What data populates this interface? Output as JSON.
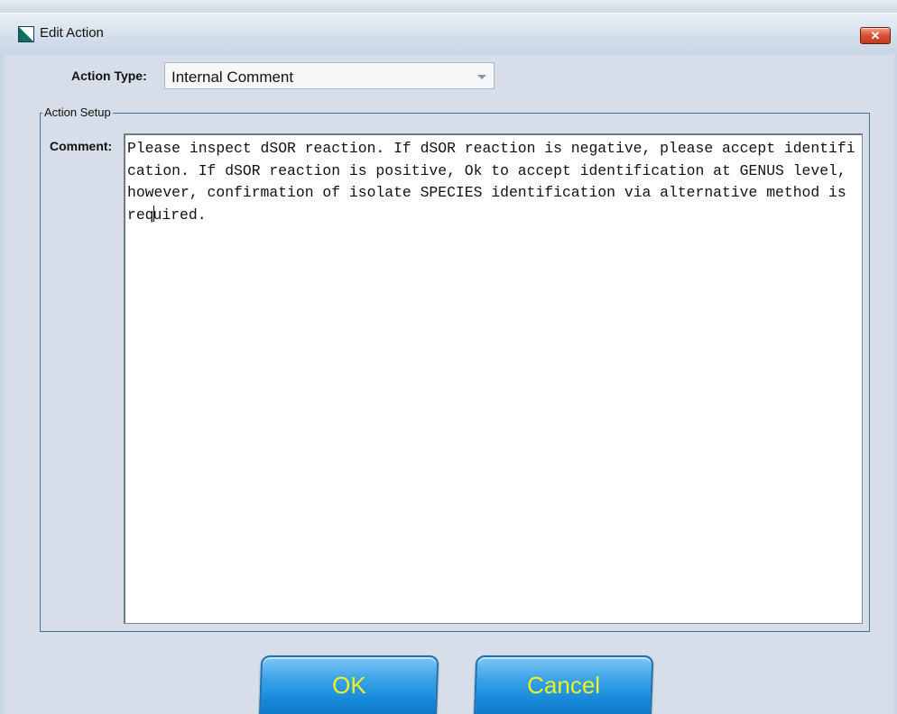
{
  "window": {
    "title": "Edit Action",
    "close_label": "✕"
  },
  "form": {
    "action_type_label": "Action Type:",
    "action_type_value": "Internal Comment",
    "group_label": "Action Setup",
    "comment_label": "Comment:",
    "comment_before_caret": "Please inspect dSOR reaction. If dSOR reaction is negative, please accept identification. If dSOR reaction is positive, Ok to accept identification at GENUS level, however, confirmation of isolate SPECIES identification via alternative method is req",
    "comment_after_caret": "uired."
  },
  "buttons": {
    "ok_label": "OK",
    "cancel_label": "Cancel"
  },
  "colors": {
    "button_text": "#f2f21e",
    "button_fill": "#1487d9"
  }
}
